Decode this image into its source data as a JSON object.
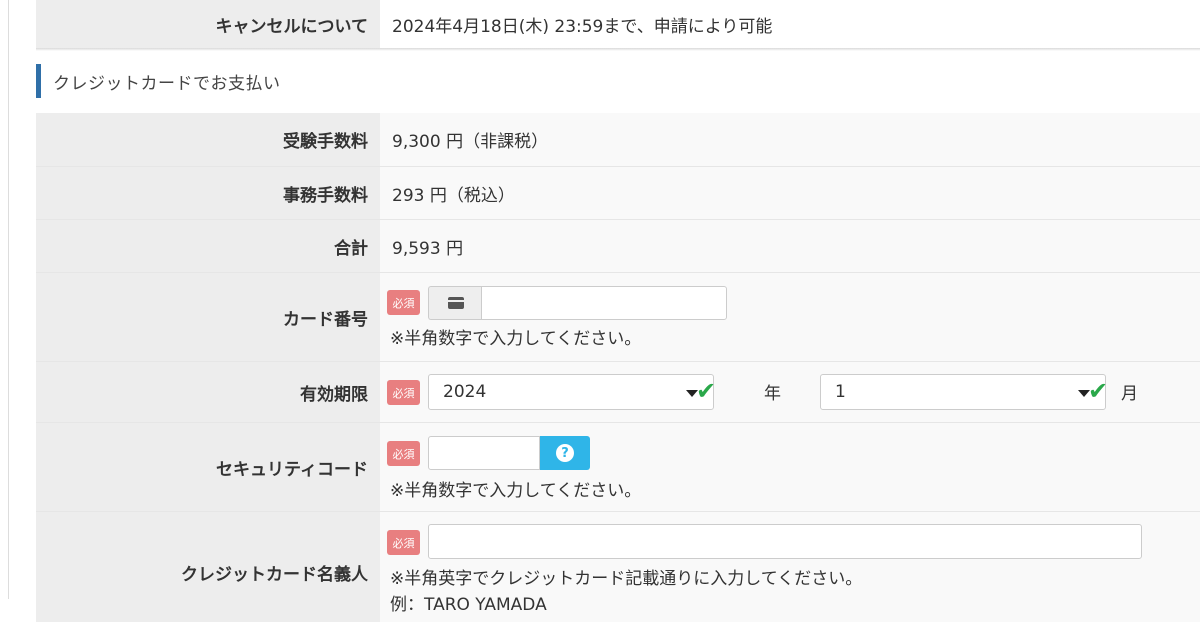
{
  "cancel": {
    "label": "キャンセルについて",
    "value": "2024年4月18日(木) 23:59まで、申請により可能"
  },
  "section": {
    "title": "クレジットカードでお支払い"
  },
  "fees": [
    {
      "label": "受験手数料",
      "value": "9,300 円（非課税）"
    },
    {
      "label": "事務手数料",
      "value": "293 円（税込）"
    },
    {
      "label": "合計",
      "value": "9,593 円"
    }
  ],
  "required_badge": "必須",
  "card_number": {
    "label": "カード番号",
    "value": "",
    "hint": "※半角数字で入力してください。",
    "icon": "credit-card-icon"
  },
  "expiry": {
    "label": "有効期限",
    "year_value": "2024",
    "year_unit": "年",
    "month_value": "1",
    "month_unit": "月"
  },
  "security_code": {
    "label": "セキュリティコード",
    "value": "",
    "hint": "※半角数字で入力してください。",
    "help_icon": "question-circle-icon"
  },
  "card_holder": {
    "label": "クレジットカード名義人",
    "value": "",
    "hint": "※半角英字でクレジットカード記載通りに入力してください。",
    "example": "例：TARO YAMADA"
  },
  "colors": {
    "section_bar": "#2f6fa8",
    "required_badge": "#e87f80",
    "check": "#2aa84a",
    "help_button": "#2fb5e8"
  }
}
